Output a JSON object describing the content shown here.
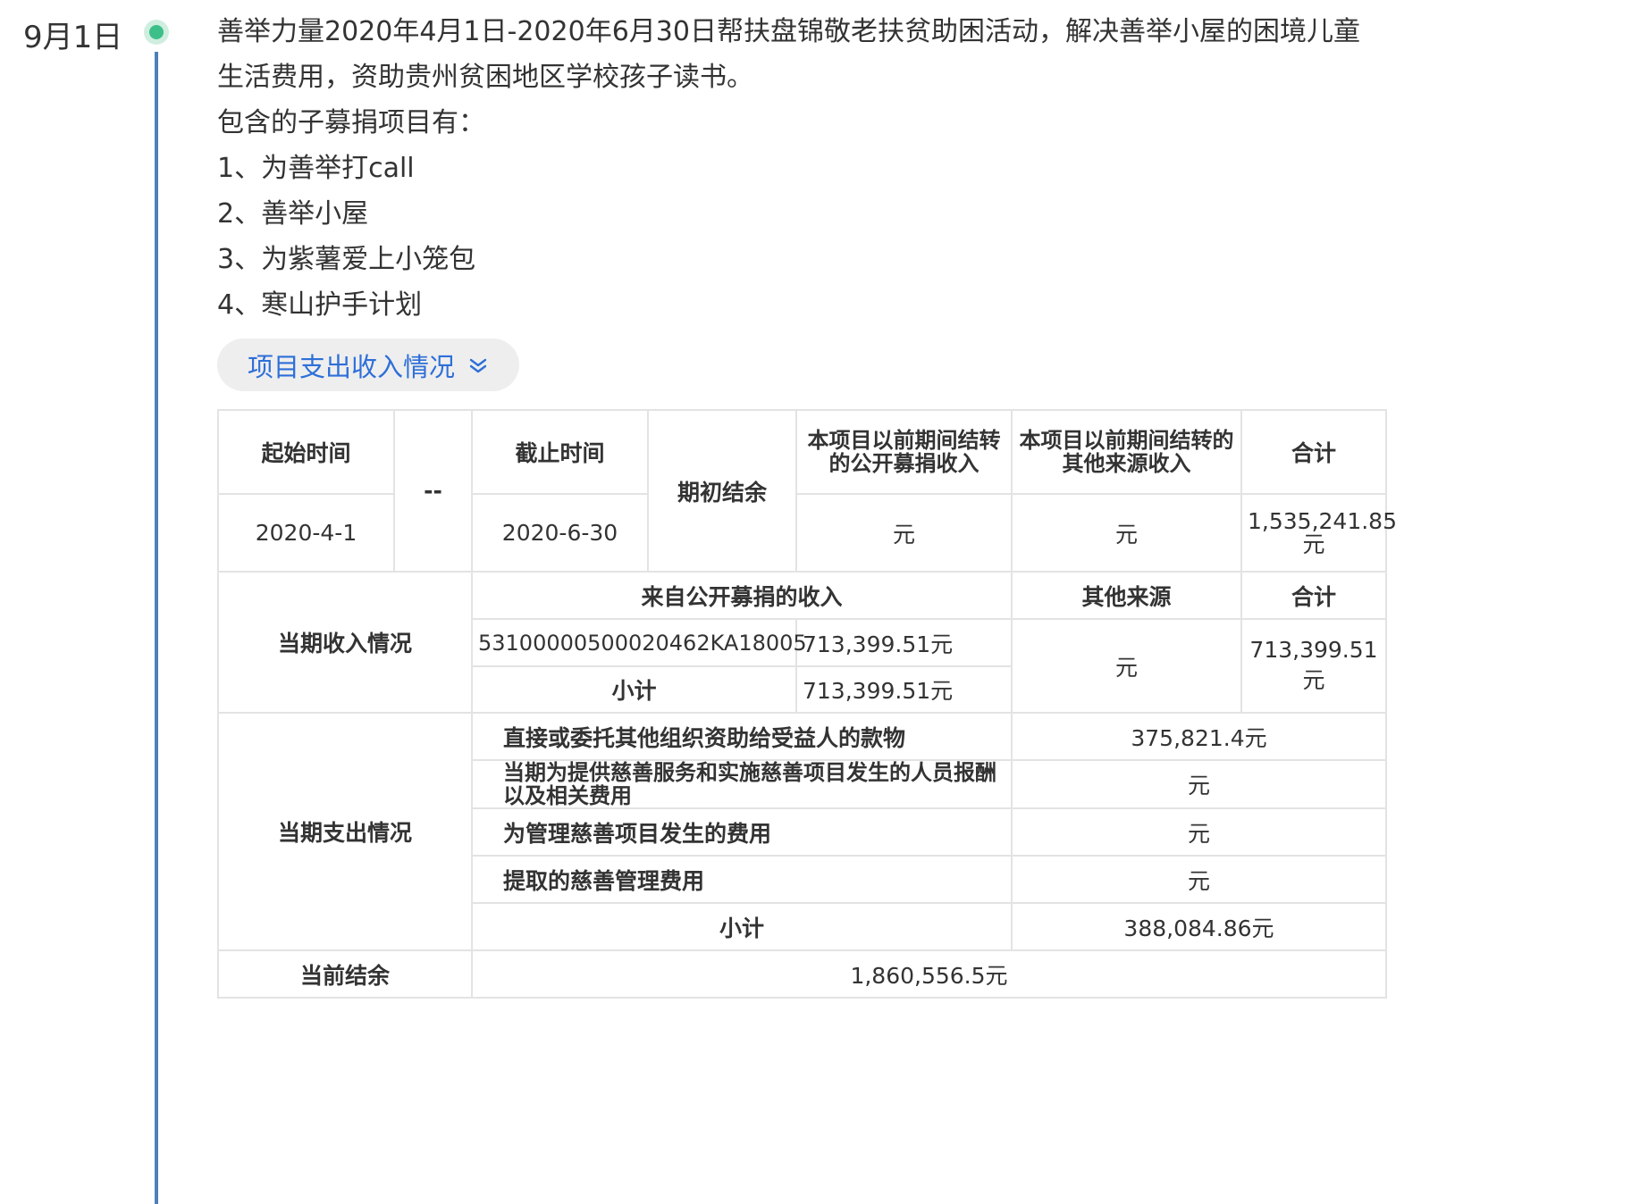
{
  "timeline": {
    "date": "9月1日"
  },
  "description": {
    "lines": [
      "善举力量2020年4月1日-2020年6月30日帮扶盘锦敬老扶贫助困活动，解决善举小屋的困境儿童生活费用，资助贵州贫困地区学校孩子读书。",
      "包含的子募捐项目有：",
      "1、为善举打call",
      "2、善举小屋",
      "3、为紫薯爱上小笼包",
      "4、寒山护手计划"
    ]
  },
  "toggle": {
    "label": "项目支出收入情况",
    "icon": "chevron-double-down-icon",
    "color": "#2e6fd8"
  },
  "table": {
    "header": {
      "start_time": "起始时间",
      "separator": "--",
      "end_time": "截止时间",
      "opening_balance": "期初结余",
      "carry_public": "本项目以前期间结转的公开募捐收入",
      "carry_other": "本项目以前期间结转的其他来源收入",
      "total": "合计"
    },
    "period": {
      "start": "2020-4-1",
      "end": "2020-6-30",
      "carry_public_value": "元",
      "carry_other_value": "元",
      "total_value": "1,535,241.85元"
    },
    "income": {
      "label": "当期收入情况",
      "public_header": "来自公开募捐的收入",
      "other_header": "其他来源",
      "total_header": "合计",
      "record_code": "53100000500020462KA18005",
      "record_value": "713,399.51元",
      "subtotal_label": "小计",
      "subtotal_value": "713,399.51元",
      "other_value": "元",
      "total_value": "713,399.51元"
    },
    "expense": {
      "label": "当期支出情况",
      "rows": [
        {
          "label": "直接或委托其他组织资助给受益人的款物",
          "value": "375,821.4元"
        },
        {
          "label": "当期为提供慈善服务和实施慈善项目发生的人员报酬以及相关费用",
          "value": "元"
        },
        {
          "label": "为管理慈善项目发生的费用",
          "value": "元"
        },
        {
          "label": "提取的慈善管理费用",
          "value": "元"
        }
      ],
      "subtotal_label": "小计",
      "subtotal_value": "388,084.86元"
    },
    "balance": {
      "label": "当前结余",
      "value": "1,860,556.5元"
    }
  }
}
